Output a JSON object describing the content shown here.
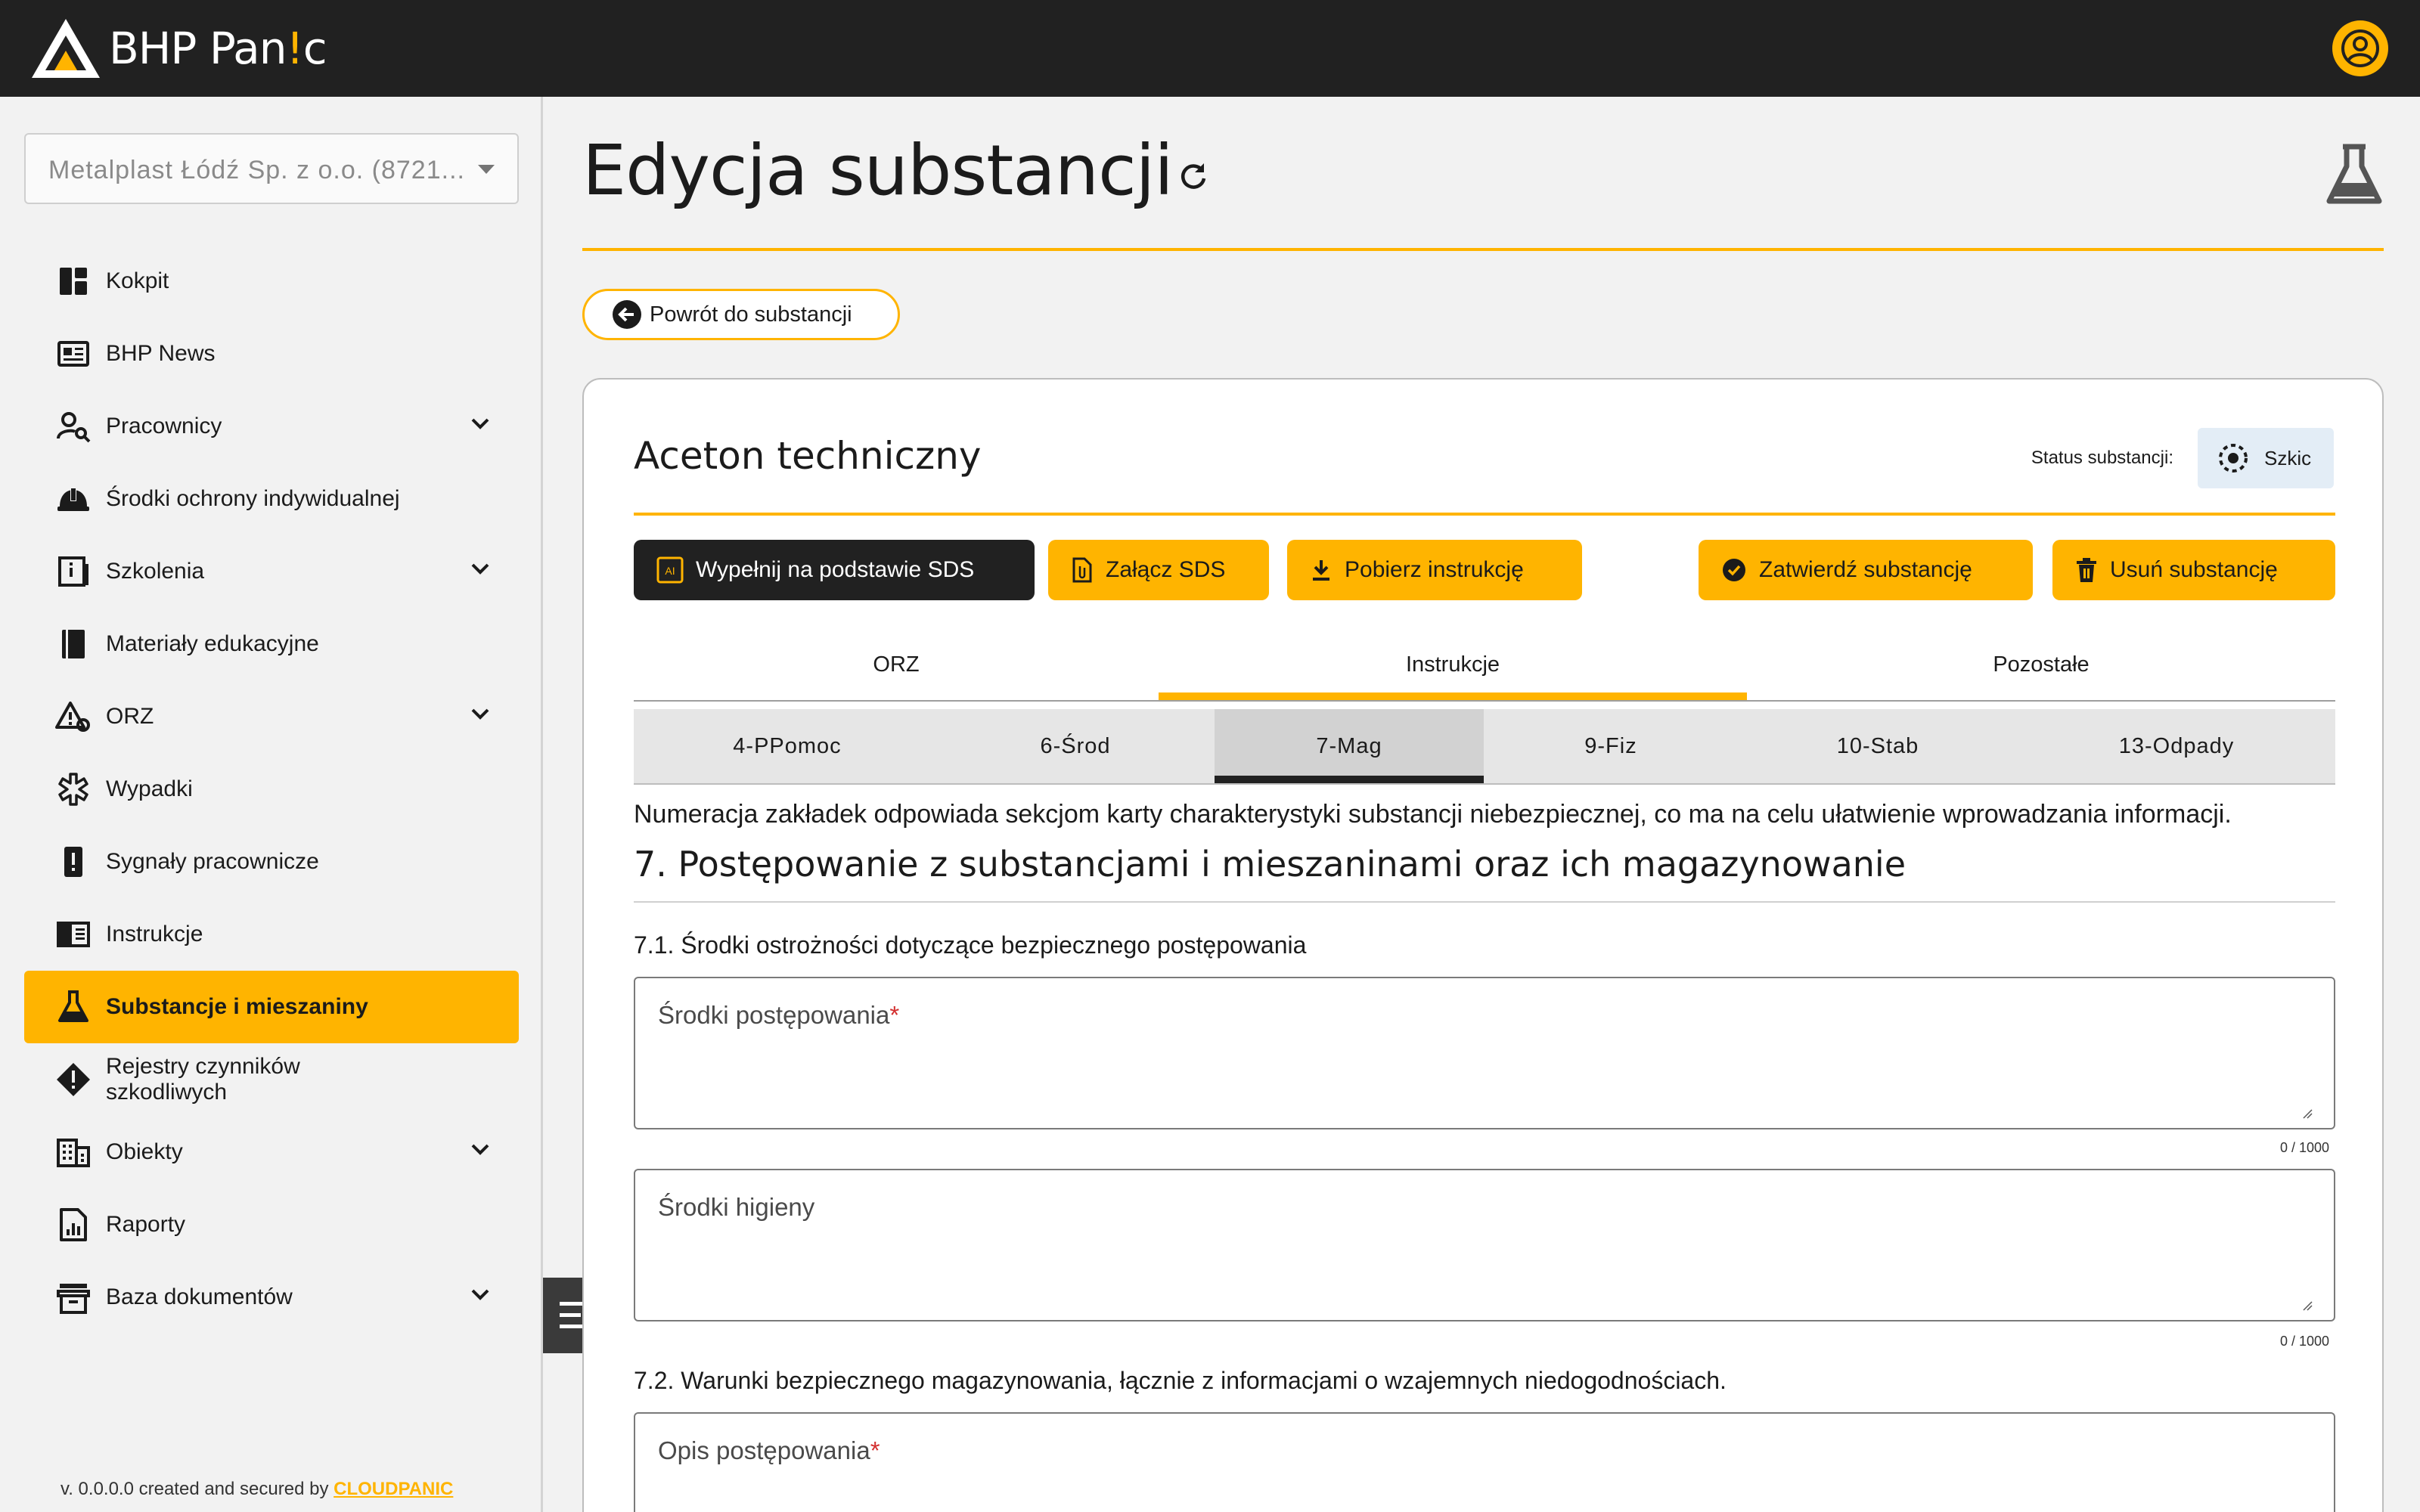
{
  "app": {
    "name_main": "BHP Pan",
    "name_accent": "!",
    "name_end": "c"
  },
  "sidebar": {
    "company": "Metalplast Łódź Sp. z o.o. (8721...",
    "items": [
      {
        "label": "Kokpit",
        "icon": "dashboard-icon"
      },
      {
        "label": "BHP News",
        "icon": "newspaper-icon"
      },
      {
        "label": "Pracownicy",
        "icon": "person-search-icon",
        "expandable": true
      },
      {
        "label": "Środki ochrony indywidualnej",
        "icon": "hard-hat-icon"
      },
      {
        "label": "Szkolenia",
        "icon": "training-icon",
        "expandable": true
      },
      {
        "label": "Materiały edukacyjne",
        "icon": "book-icon"
      },
      {
        "label": "ORZ",
        "icon": "risk-icon",
        "expandable": true
      },
      {
        "label": "Wypadki",
        "icon": "medical-icon"
      },
      {
        "label": "Sygnały pracownicze",
        "icon": "alert-icon"
      },
      {
        "label": "Instrukcje",
        "icon": "instructions-icon"
      },
      {
        "label": "Substancje i mieszaniny",
        "icon": "flask-icon",
        "active": true
      },
      {
        "label": "Rejestry czynników szkodliwych",
        "icon": "warning-diamond-icon"
      },
      {
        "label": "Obiekty",
        "icon": "building-icon",
        "expandable": true
      },
      {
        "label": "Raporty",
        "icon": "report-icon"
      },
      {
        "label": "Baza dokumentów",
        "icon": "archive-icon",
        "expandable": true
      }
    ],
    "version_text": "v. 0.0.0.0 created and secured by ",
    "version_brand": "CLOUDPANIC"
  },
  "page": {
    "title": "Edycja substancji",
    "back_label": "Powrót do substancji"
  },
  "substance": {
    "name": "Aceton techniczny",
    "status_label": "Status substancji:",
    "status_value": "Szkic"
  },
  "actions": {
    "fill_sds": "Wypełnij na podstawie SDS",
    "fill_sds_badge": "AI",
    "attach_sds": "Załącz SDS",
    "download_instruction": "Pobierz instrukcję",
    "approve": "Zatwierdź substancję",
    "delete": "Usuń substancję"
  },
  "tabs": [
    "ORZ",
    "Instrukcje",
    "Pozostałe"
  ],
  "active_tab": "Instrukcje",
  "subtabs": [
    "4-PPomoc",
    "6-Środ",
    "7-Mag",
    "9-Fiz",
    "10-Stab",
    "13-Odpady"
  ],
  "active_subtab": "7-Mag",
  "content": {
    "info": "Numeracja zakładek odpowiada sekcjom karty charakterystyki substancji niebezpiecznej, co ma na celu ułatwienie wprowadzania informacji.",
    "section_title": "7. Postępowanie z substancjami i mieszaninami oraz ich magazynowanie",
    "sub_7_1": "7.1. Środki ostrożności dotyczące bezpiecznego postępowania",
    "field_1_label": "Środki postępowania",
    "field_1_counter": "0 / 1000",
    "field_2_label": "Środki higieny",
    "field_2_counter": "0 / 1000",
    "sub_7_2": "7.2. Warunki bezpiecznego magazynowania, łącznie z informacjami o wzajemnych niedogodnościach.",
    "field_3_label": "Opis postępowania",
    "required_mark": "*"
  },
  "colors": {
    "accent": "#ffb400",
    "topbar": "#212121",
    "status_chip": "#e3edf6"
  }
}
